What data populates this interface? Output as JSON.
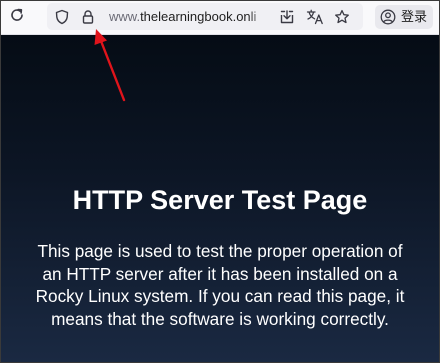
{
  "toolbar": {
    "reload_icon": "reload-icon",
    "url": {
      "scheme": "www.",
      "host": "thelearningbook.onli"
    },
    "tracking_protection_icon": "shield-icon",
    "site_security_icon": "lock-icon",
    "actions": [
      "download-page-icon",
      "translate-icon",
      "bookmark-star-icon"
    ],
    "account": {
      "icon": "account-avatar-icon",
      "label": "登录"
    }
  },
  "page": {
    "title": "HTTP Server Test Page",
    "body": "This page is used to test the proper operation of an HTTP server after it has been installed on a Rocky Linux system. If you can read this page, it means that the software is working correctly."
  },
  "annotation": {
    "arrow_icon": "red-arrow-pointing-to-lock",
    "color": "#e0141b"
  },
  "colors": {
    "page_background_top": "#050c15",
    "page_background_bottom": "#1a2942",
    "text": "#ffffff",
    "toolbar": "#f9f9fb"
  }
}
